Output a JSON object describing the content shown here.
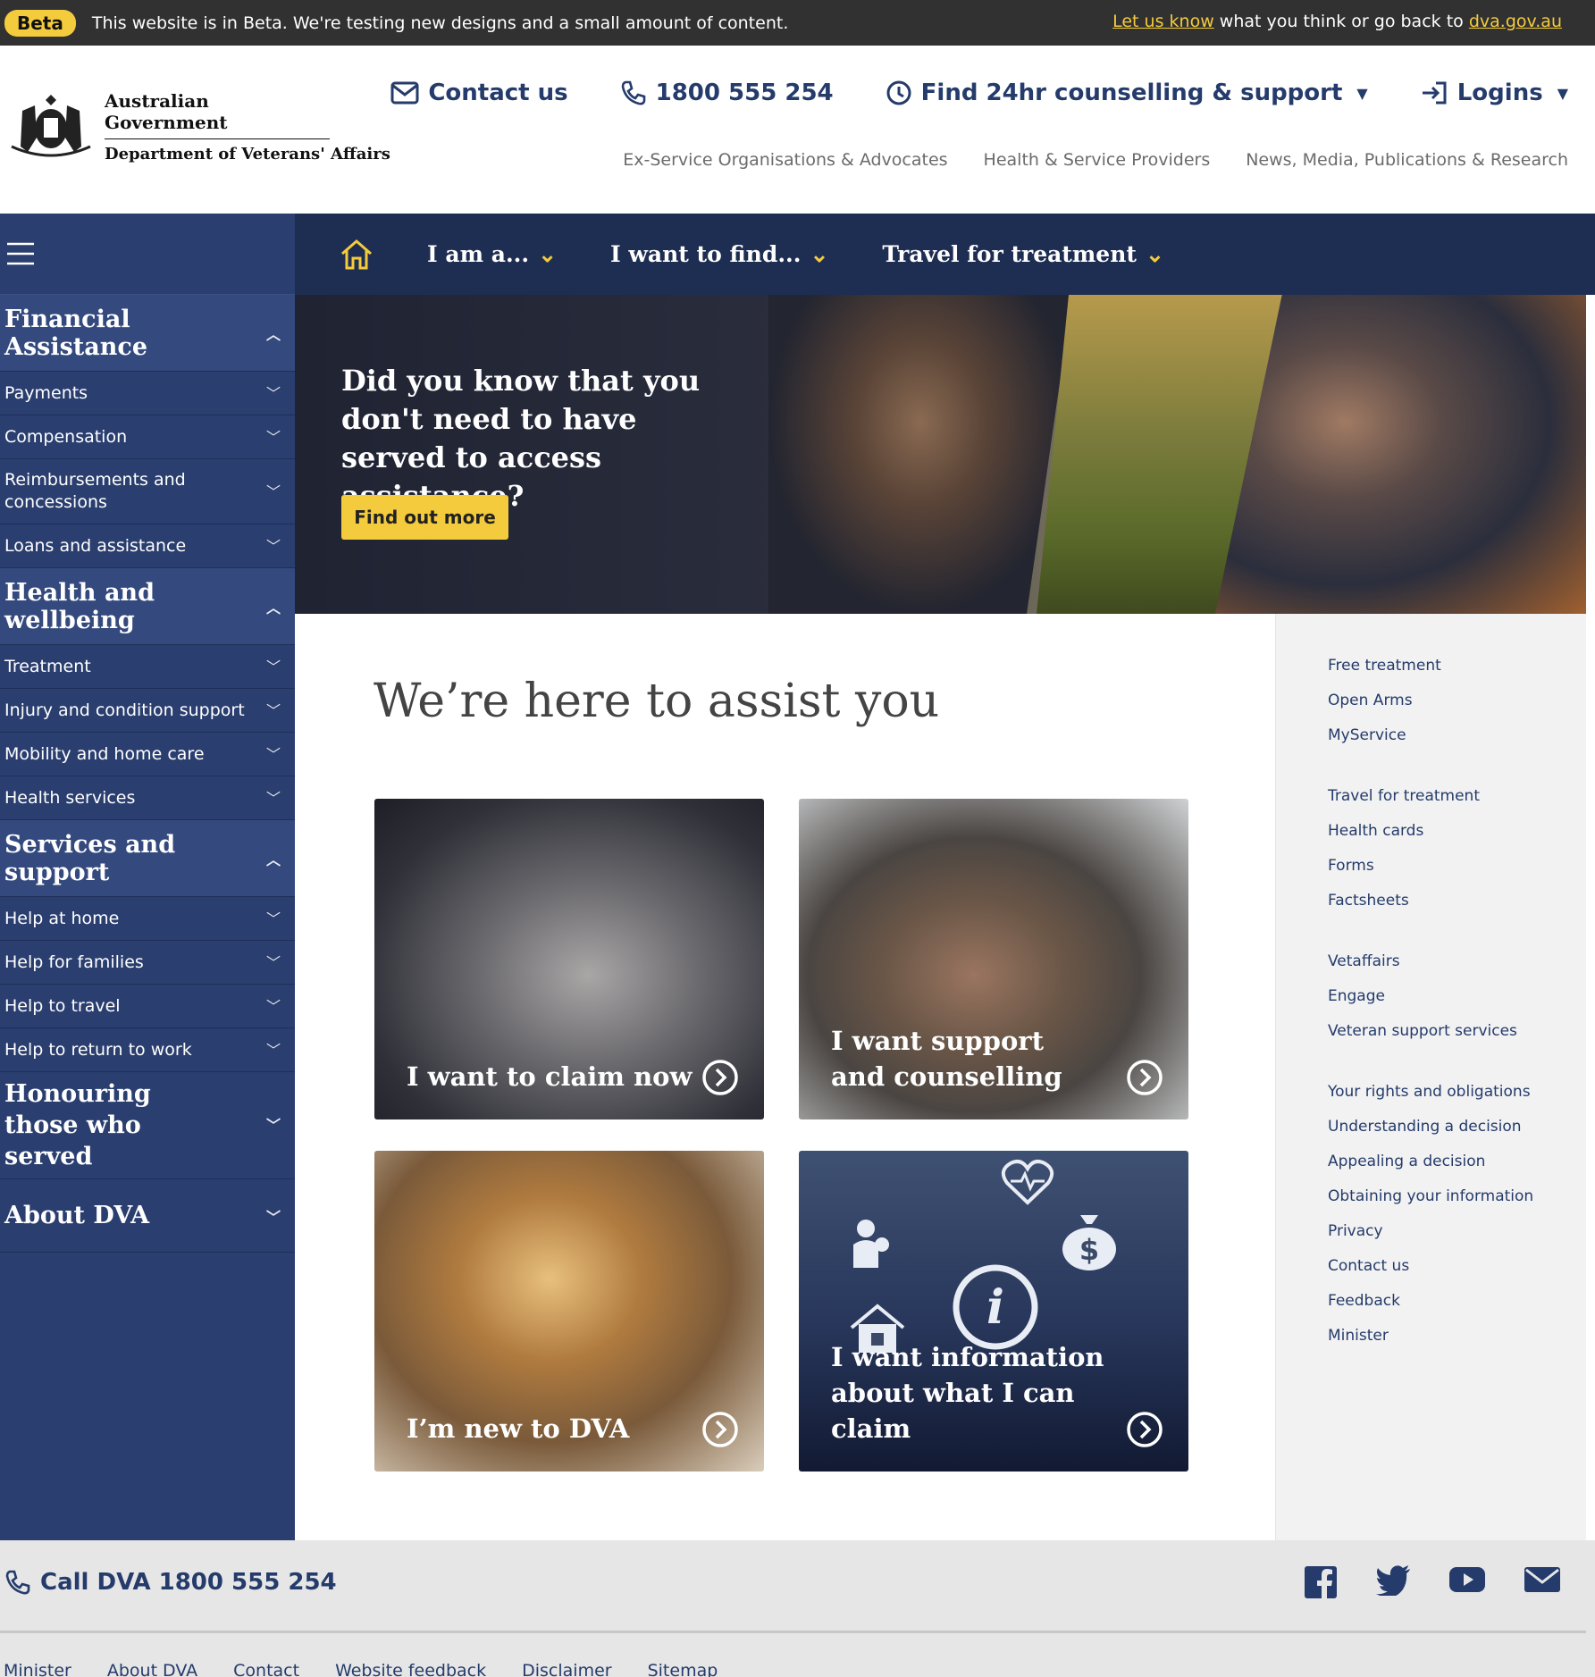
{
  "beta": {
    "pill": "Beta",
    "message": "This website is in Beta. We're testing new designs and a small amount of content.",
    "let_us_know": "Let us know",
    "middle": "what you think or go back to",
    "site_link": "dva.gov.au"
  },
  "logo": {
    "line1": "Australian Government",
    "line2": "Department of Veterans' Affairs"
  },
  "top_links": {
    "contact": "Contact us",
    "phone": "1800 555 254",
    "counselling": "Find 24hr counselling & support",
    "logins": "Logins"
  },
  "secondary_links": [
    "Ex-Service Organisations & Advocates",
    "Health & Service Providers",
    "News, Media, Publications & Research"
  ],
  "nav": {
    "items": [
      "I am a...",
      "I want to find...",
      "Travel for treatment"
    ]
  },
  "sidebar": {
    "sections": [
      {
        "title": "Financial Assistance",
        "items": [
          "Payments",
          "Compensation",
          "Reimbursements and concessions",
          "Loans and assistance"
        ]
      },
      {
        "title": "Health and wellbeing",
        "items": [
          "Treatment",
          "Injury and condition support",
          "Mobility and home care",
          "Health services"
        ]
      },
      {
        "title": "Services and support",
        "items": [
          "Help at home",
          "Help for families",
          "Help to travel",
          "Help to return to work"
        ]
      },
      {
        "title": "Honouring those who served",
        "items": []
      },
      {
        "title": "About DVA",
        "items": []
      }
    ]
  },
  "hero": {
    "title": "Did you know that you don't need to have served to access assistance?",
    "button": "Find out more"
  },
  "main": {
    "heading": "We’re here to assist you",
    "cards": [
      "I want to claim now",
      "I want support and counselling",
      "I’m new to DVA",
      "I want information about what I can claim"
    ]
  },
  "rail": {
    "groups": [
      [
        "Free treatment",
        "Open Arms",
        "MyService"
      ],
      [
        "Travel for treatment",
        "Health cards",
        "Forms",
        "Factsheets"
      ],
      [
        "Vetaffairs",
        "Engage",
        "Veteran support services"
      ],
      [
        "Your rights and obligations",
        "Understanding a decision",
        "Appealing a decision",
        "Obtaining your information",
        "Privacy",
        "Contact us",
        "Feedback",
        "Minister"
      ]
    ]
  },
  "footer": {
    "call": "Call DVA 1800 555 254",
    "links": [
      "Minister",
      "About DVA",
      "Contact",
      "Website feedback",
      "Disclaimer",
      "Sitemap"
    ]
  },
  "colors": {
    "navy": "#1e2d52",
    "sidebar": "#2a3e6f",
    "accent": "#f4cb3c",
    "link": "#243b6b"
  }
}
